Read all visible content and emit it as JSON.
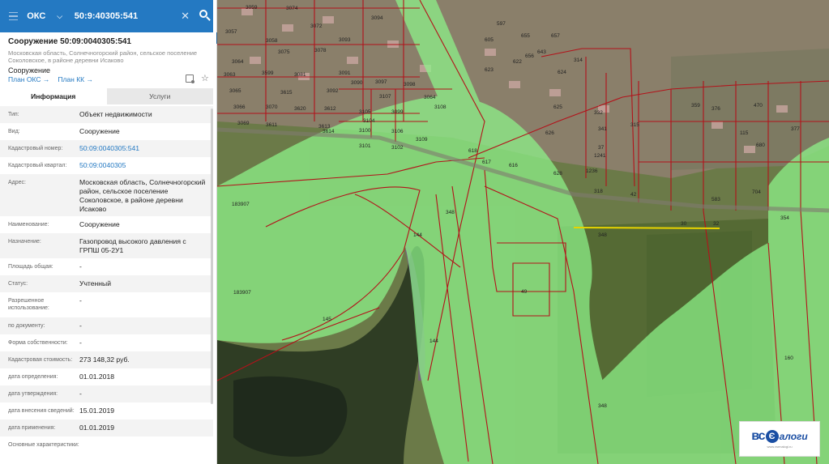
{
  "search": {
    "type_label": "ОКС",
    "query": "50:9:40305:541"
  },
  "object": {
    "title": "Сооружение 50:09:0040305:541",
    "address": "Московская область, Солнечногорский район, сельское поселение Соколовское, в районе деревни Исаково",
    "kind": "Сооружение",
    "links": [
      "План ОКС",
      "План КК"
    ]
  },
  "tabs": [
    "Информация",
    "Услуги"
  ],
  "attributes": [
    {
      "label": "Тип:",
      "value": "Объект недвижимости"
    },
    {
      "label": "Вид:",
      "value": "Сооружение"
    },
    {
      "label": "Кадастровый номер:",
      "value": "50:09:0040305:541",
      "link": true
    },
    {
      "label": "Кадастровый квартал:",
      "value": "50:09:0040305",
      "link": true
    },
    {
      "label": "Адрес:",
      "value": "Московская область, Солнечногорский район, сельское поселение Соколовское, в районе деревни Исаково"
    },
    {
      "label": "Наименование:",
      "value": "Сооружение"
    },
    {
      "label": "Назначение:",
      "value": "Газопровод высокого давления с ГРПШ 05-2У1"
    },
    {
      "label": "Площадь общая:",
      "value": "-"
    },
    {
      "label": "Статус:",
      "value": "Учтенный"
    },
    {
      "label": "Разрешенное использование:",
      "value": "-"
    },
    {
      "label": "по документу:",
      "value": "-"
    },
    {
      "label": "Форма собственности:",
      "value": "-"
    },
    {
      "label": "Кадастровая стоимость:",
      "value": "273 148,32 руб."
    },
    {
      "label": "дата определения:",
      "value": "01.01.2018"
    },
    {
      "label": "дата утверждения:",
      "value": "-"
    },
    {
      "label": "дата внесения сведений:",
      "value": "15.01.2019"
    },
    {
      "label": "дата применения:",
      "value": "01.01.2019"
    },
    {
      "label": "Основные характеристики:",
      "value": ""
    }
  ],
  "map": {
    "parcel_labels": [
      "3059",
      "3074",
      "3057",
      "3058",
      "3072",
      "3094",
      "3093",
      "3064",
      "3075",
      "3078",
      "3091",
      "3063",
      "3599",
      "3081",
      "3090",
      "3097",
      "3098",
      "3065",
      "3615",
      "3092",
      "3107",
      "3066",
      "3070",
      "3620",
      "3612",
      "3105",
      "3099",
      "3064",
      "3613",
      "3104",
      "3069",
      "3611",
      "3614",
      "3100",
      "3106",
      "3101",
      "3102",
      "3109",
      "3108",
      "183907",
      "183907",
      "348",
      "348",
      "348",
      "144",
      "144",
      "145",
      "49",
      "618",
      "617",
      "616",
      "622",
      "623",
      "624",
      "625",
      "626",
      "628",
      "643",
      "314",
      "332",
      "341",
      "37",
      "318",
      "1236",
      "1241",
      "42",
      "30",
      "32",
      "315",
      "359",
      "470",
      "376",
      "377",
      "115",
      "680",
      "583",
      "704",
      "354",
      "160",
      "597",
      "605",
      "655",
      "656",
      "657",
      "661"
    ],
    "colors": {
      "zone_green": "#7ee07a",
      "border_red": "#b3121a",
      "line_yellow": "#e8d400"
    }
  },
  "watermark": {
    "brand": "ВСЕ НАЛОГИ",
    "site": "www.vsenalogi.ru"
  }
}
